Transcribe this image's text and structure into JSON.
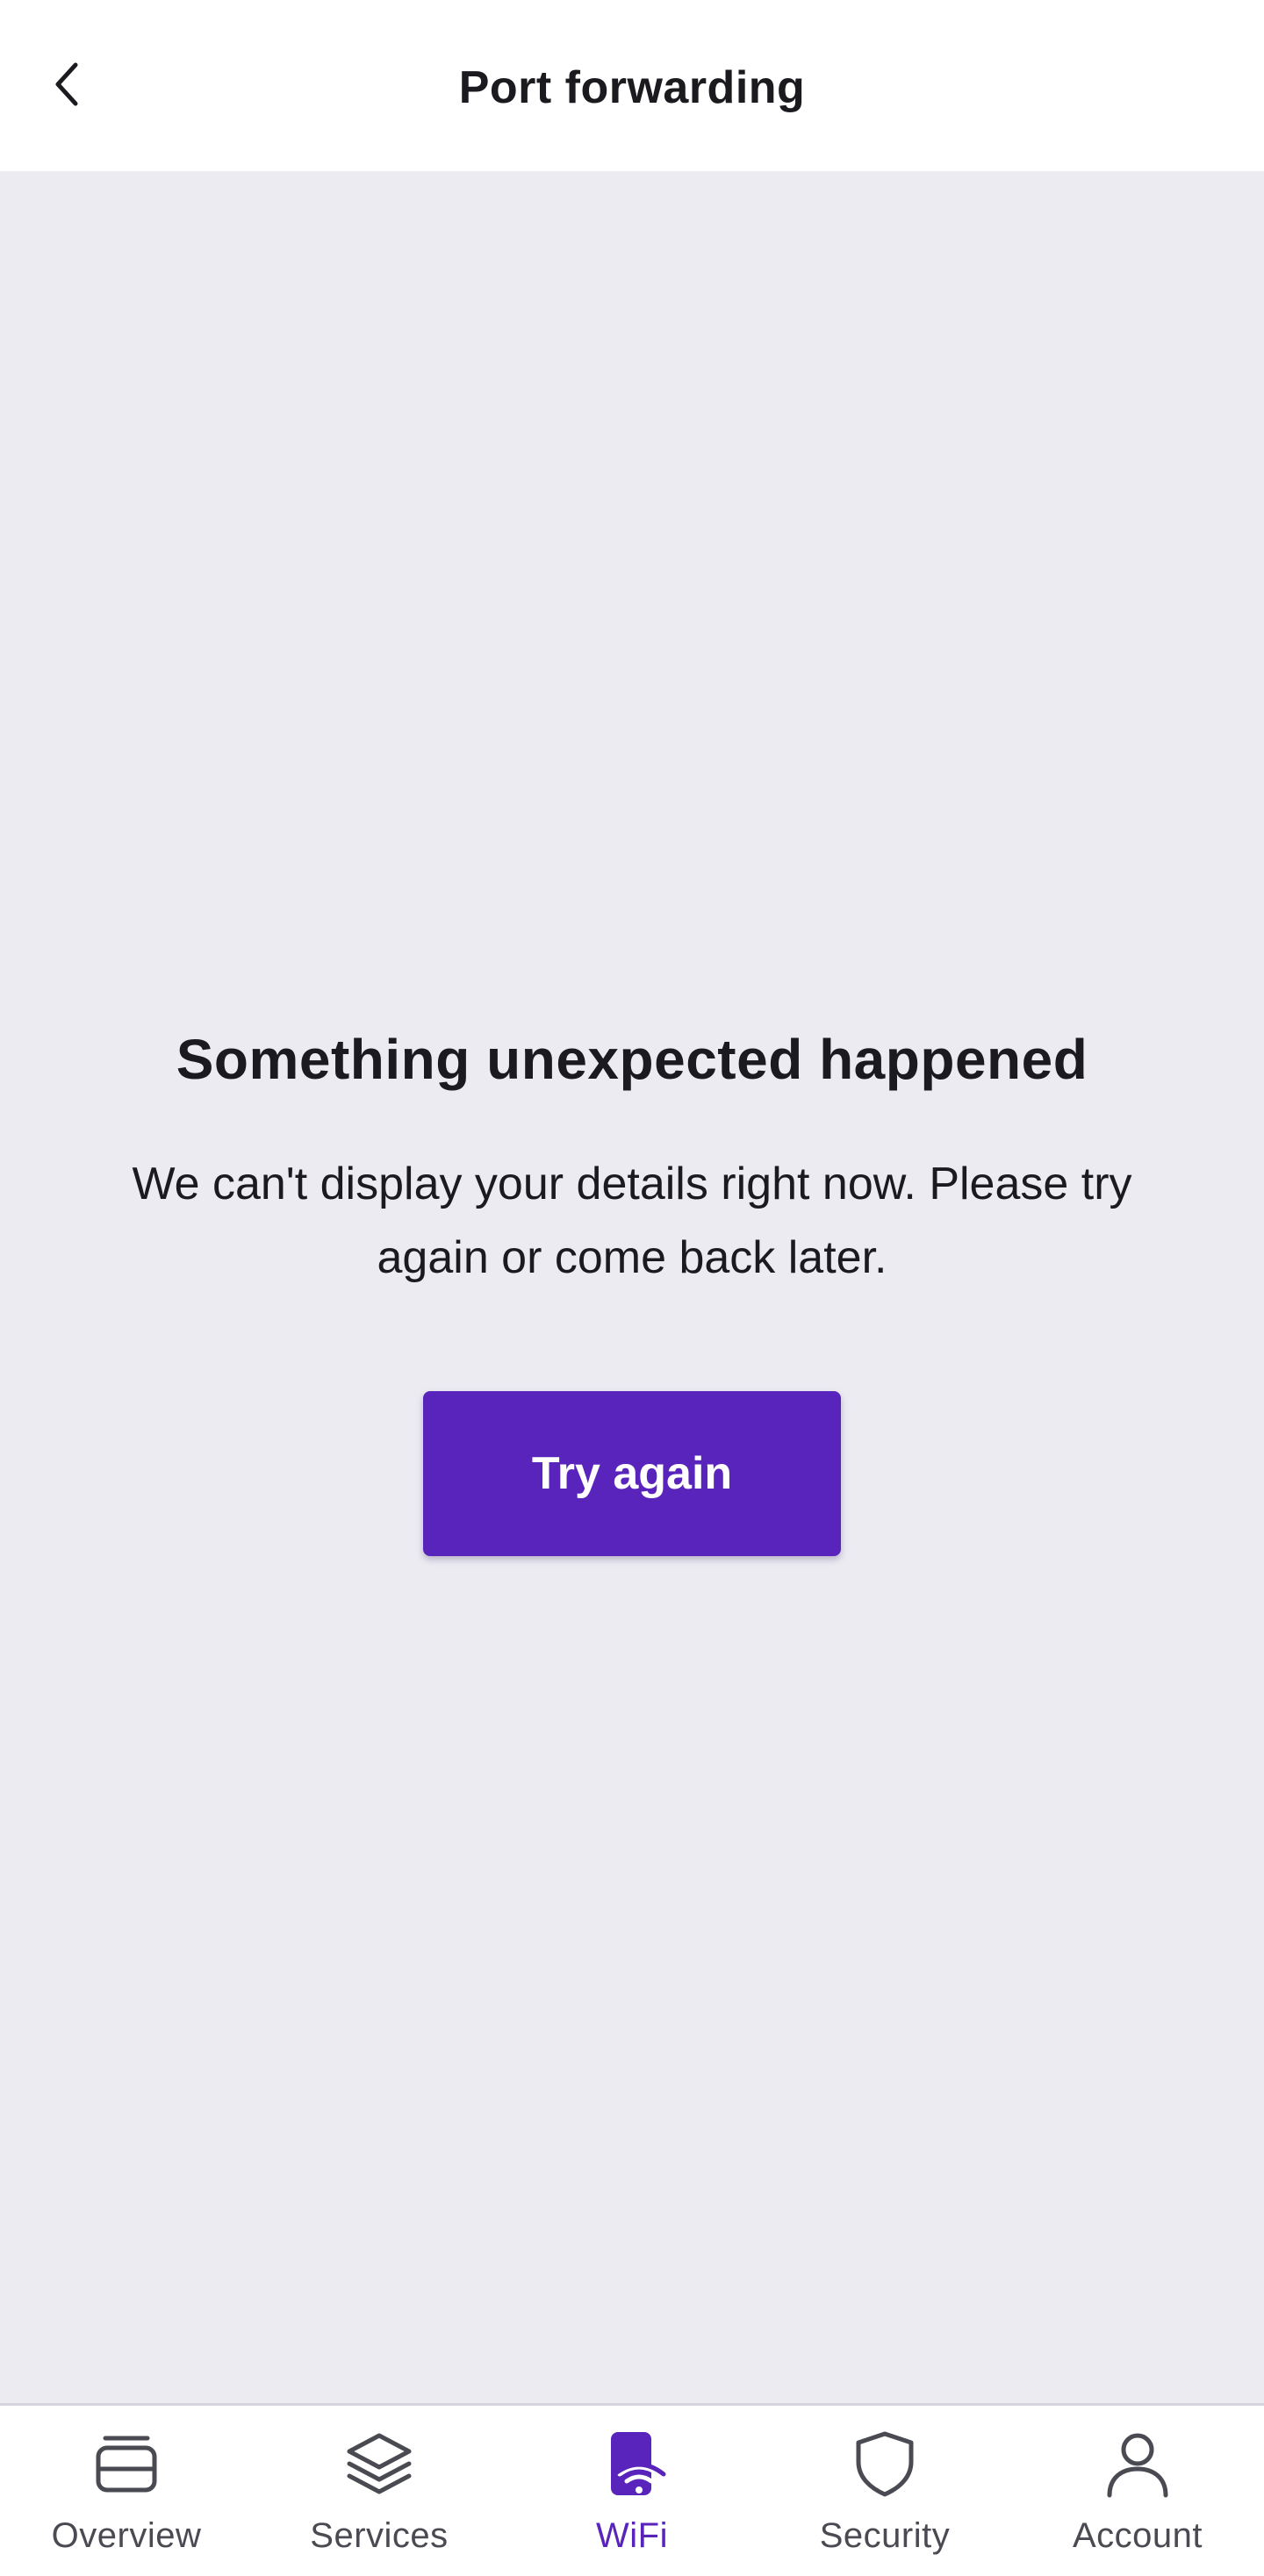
{
  "header": {
    "title": "Port forwarding",
    "back_icon": "chevron-left-icon"
  },
  "error": {
    "title": "Something unexpected happened",
    "message": "We can't display your details right now. Please try again or come back later.",
    "retry_label": "Try again"
  },
  "colors": {
    "accent": "#5924bb",
    "background": "#ecebf1",
    "surface": "#ffffff",
    "text": "#1a1a1f",
    "nav_inactive": "#4a4a52"
  },
  "nav": {
    "items": [
      {
        "label": "Overview",
        "icon": "overview-icon",
        "active": false
      },
      {
        "label": "Services",
        "icon": "layers-icon",
        "active": false
      },
      {
        "label": "WiFi",
        "icon": "wifi-phone-icon",
        "active": true
      },
      {
        "label": "Security",
        "icon": "shield-icon",
        "active": false
      },
      {
        "label": "Account",
        "icon": "person-icon",
        "active": false
      }
    ]
  }
}
